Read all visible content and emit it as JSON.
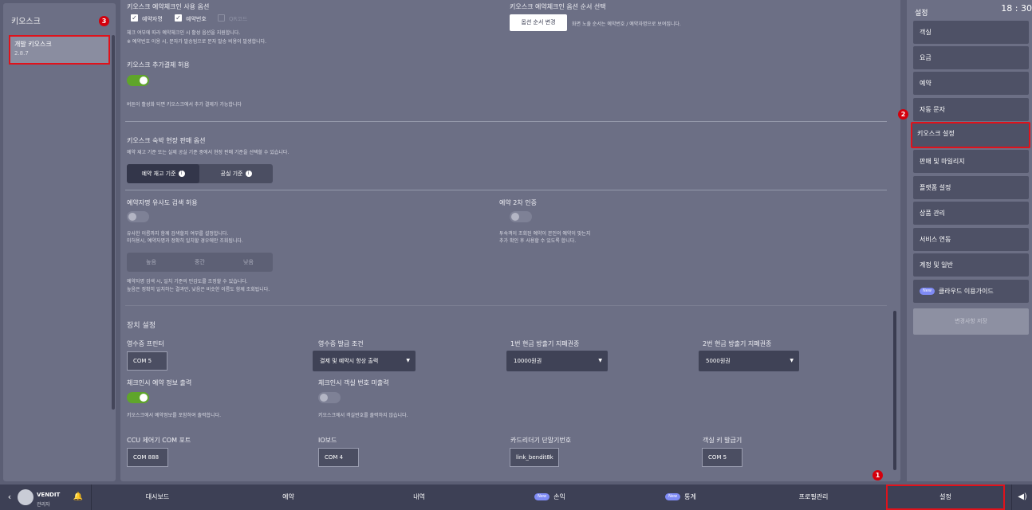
{
  "left_panel": {
    "title": "키오스크",
    "item_name": "개발 키오스크",
    "item_version": "2.8.7"
  },
  "main": {
    "usage_options_title": "키오스크 예약체크인 사용 옵션",
    "check_guest_name": "예약자명",
    "check_reservation_no": "예약번호",
    "check_third": "QR코드",
    "usage_desc1": "체크 여부에 따라 예약체크인 시 활성 옵션을 지원합니다.",
    "usage_desc2": "※ 예약번호 이용 시, 문자가 발송됨으로 문자 발송 비용이 발생합니다.",
    "order_title": "키오스크 예약체크인 옵션 순서 선택",
    "order_button": "옵션 순서 변경",
    "order_desc": "화면 노출 순서는 예약번호 / 예약자명으로 보여집니다.",
    "extra_payment_title": "키오스크 추가결제 허용",
    "extra_payment_desc": "버튼이 활성화 되면 키오스크에서 추가 결제가 가능합니다",
    "extra_payment_on": true,
    "sales_option_title": "키오스크 숙박 현장 판매 옵션",
    "sales_option_desc": "예약 재고 기준 또는 실제 공실 기준 중에서 현장 판매 기준을 선택할 수 있습니다.",
    "sales_opt1": "예약 재고 기준",
    "sales_opt2": "공실 기준",
    "similar_search_title": "예약자명 유사도 검색 허용",
    "similar_search_on": false,
    "similar_desc1": "유사한 이름까지 함께 검색할지 여부를 설정합니다.",
    "similar_desc2": "미허용시, 예약자명과 정확히 일치할 경우에만 조회됩니다.",
    "level_high": "높음",
    "level_mid": "중간",
    "level_low": "낮음",
    "level_desc1": "예약자명 검색 시, 일치 기준의 민감도를 조정할 수 있습니다.",
    "level_desc2": "높음은 정확히 일치하는 결과만, 낮음은 비슷한 이름도 함께 조회됩니다.",
    "two_factor_title": "예약 2차 인증",
    "two_factor_on": false,
    "two_factor_desc1": "투숙객이 조회된 예약이 본인의 예약이 맞는지",
    "two_factor_desc2": "추가 확인 후 사용할 수 있도록 합니다.",
    "device_title": "장치 설정",
    "receipt_printer_label": "영수증 프린터",
    "receipt_printer_value": "COM 5",
    "receipt_condition_label": "영수증 발급 조건",
    "receipt_condition_value": "결제 및 예약시 항상 출력",
    "cash1_label": "1번 현금 방출기 지폐권종",
    "cash1_value": "10000원권",
    "cash2_label": "2번 현금 방출기 지폐권종",
    "cash2_value": "5000원권",
    "checkin_print_label": "체크인시 예약 정보 출력",
    "checkin_print_on": true,
    "checkin_print_desc": "키오스크에서 예약정보를 포함하여 출력합니다.",
    "room_no_label": "체크인시 객실 번호 미출력",
    "room_no_on": false,
    "room_no_desc": "키오스크에서 객실번호를 출력하지 않습니다.",
    "ccu_label": "CCU 제어기 COM 포트",
    "ccu_value": "COM 888",
    "io_label": "IO보드",
    "io_value": "COM 4",
    "card_label": "카드리더기 단말기번호",
    "card_value": "link_bendit8k",
    "key_label": "객실 키 발급기",
    "key_value": "COM 5"
  },
  "right_panel": {
    "title": "설정",
    "clock": "18 : 30",
    "items": [
      "객실",
      "요금",
      "예약",
      "자동 문자",
      "키오스크 설정",
      "판매 및 마일리지",
      "플랫폼 설정",
      "상품 관리",
      "서비스 연동",
      "계정 및 일반"
    ],
    "guide_badge": "New",
    "guide_label": "클라우드 이용가이드",
    "save_button": "변경사항 저장"
  },
  "bottom_nav": {
    "brand": "VENDIT",
    "user_role": "관리자",
    "items": [
      "대시보드",
      "예약",
      "내역",
      "손익",
      "통계",
      "프로필관리",
      "설정"
    ],
    "new_badge": "New"
  },
  "markers": [
    "1",
    "2",
    "3"
  ],
  "colors": {
    "highlight": "#e0121b",
    "toggle_on": "#5fa52a",
    "panel": "#6c6f85",
    "bar": "#3d4055"
  }
}
